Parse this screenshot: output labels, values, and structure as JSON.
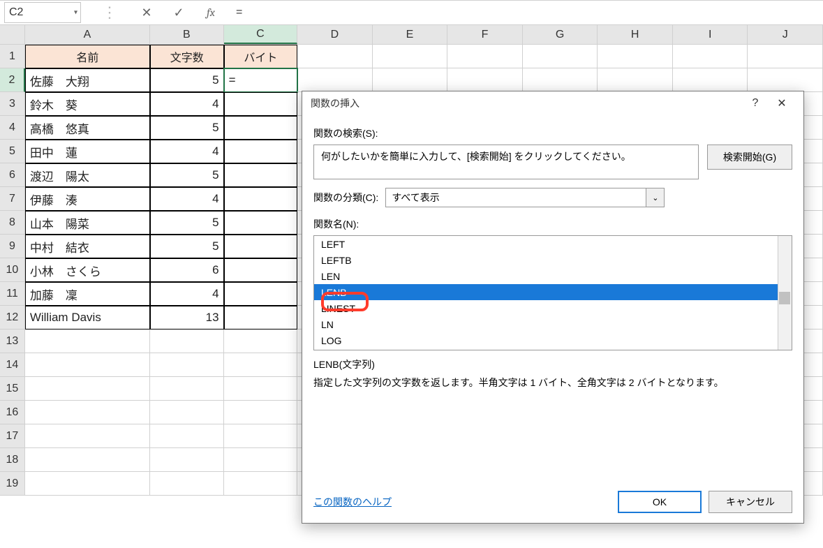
{
  "formula_bar": {
    "name_box": "C2",
    "formula": "="
  },
  "columns": [
    "A",
    "B",
    "C",
    "D",
    "E",
    "F",
    "G",
    "H",
    "I",
    "J"
  ],
  "col_widths": [
    "cA",
    "cB",
    "cC",
    "cR",
    "cR",
    "cR",
    "cR",
    "cR",
    "cR",
    "cR"
  ],
  "active_col": "C",
  "active_row": 2,
  "table": {
    "headers": [
      "名前",
      "文字数",
      "バイト"
    ],
    "rows": [
      {
        "name": "佐藤　大翔",
        "count": 5,
        "bytes": "="
      },
      {
        "name": "鈴木　葵",
        "count": 4,
        "bytes": ""
      },
      {
        "name": "高橋　悠真",
        "count": 5,
        "bytes": ""
      },
      {
        "name": "田中　蓮",
        "count": 4,
        "bytes": ""
      },
      {
        "name": "渡辺　陽太",
        "count": 5,
        "bytes": ""
      },
      {
        "name": "伊藤　湊",
        "count": 4,
        "bytes": ""
      },
      {
        "name": "山本　陽菜",
        "count": 5,
        "bytes": ""
      },
      {
        "name": "中村　結衣",
        "count": 5,
        "bytes": ""
      },
      {
        "name": "小林　さくら",
        "count": 6,
        "bytes": ""
      },
      {
        "name": "加藤　凜",
        "count": 4,
        "bytes": ""
      },
      {
        "name": "William Davis",
        "count": 13,
        "bytes": ""
      }
    ]
  },
  "empty_rows": [
    13,
    14,
    15,
    16,
    17,
    18,
    19
  ],
  "dialog": {
    "title": "関数の挿入",
    "search_label": "関数の検索(S):",
    "search_placeholder": "何がしたいかを簡単に入力して、[検索開始] をクリックしてください。",
    "go_button": "検索開始(G)",
    "category_label": "関数の分類(C):",
    "category_value": "すべて表示",
    "funcs_label": "関数名(N):",
    "functions": [
      "LEFT",
      "LEFTB",
      "LEN",
      "LENB",
      "LINEST",
      "LN",
      "LOG"
    ],
    "selected_function": "LENB",
    "description": {
      "signature": "LENB(文字列)",
      "text": "指定した文字列の文字数を返します。半角文字は 1 バイト、全角文字は 2 バイトとなります。"
    },
    "help_link": "この関数のヘルプ",
    "ok": "OK",
    "cancel": "キャンセル"
  }
}
